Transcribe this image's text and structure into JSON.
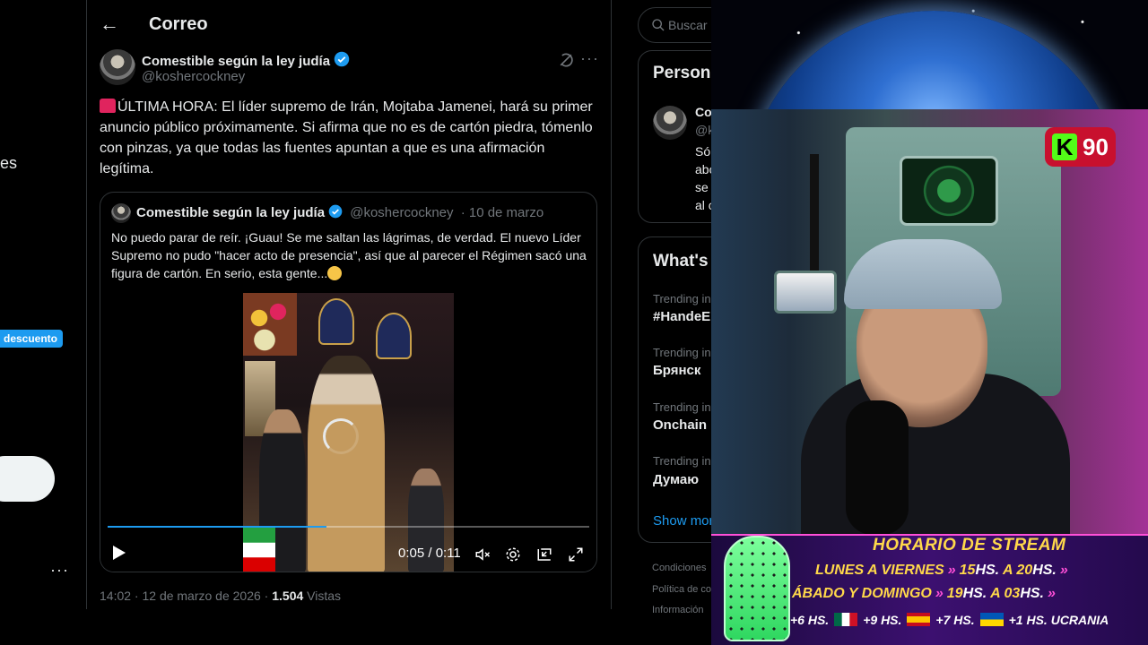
{
  "left_nav": {
    "partial_text": "es",
    "discount_badge": "descuento",
    "more_label": "···"
  },
  "header": {
    "title": "Correo",
    "back_icon": "arrow-left-icon"
  },
  "tweet": {
    "author_name": "Comestible según la ley judía",
    "author_handle": "@koshercockney",
    "text": "ÚLTIMA HORA: El líder supremo de Irán, Mojtaba Jamenei, hará su primer anuncio público próximamente. Si afirma que no es de cartón piedra, tómenlo con pinzas, ya que todas las fuentes apuntan a que es una afirmación legítima.",
    "more_label": "···",
    "timestamp": "14:02 · 12 de marzo de 2026 ·",
    "views_count": "1.504",
    "views_label": "Vistas"
  },
  "quote": {
    "author_name": "Comestible según la ley judía",
    "author_handle": "@koshercockney",
    "date": "· 10 de marzo",
    "text": "No puedo parar de reír. ¡Guau! Se me saltan las lágrimas, de verdad. El nuevo Líder Supremo no pudo \"hacer acto de presencia\", así que al parecer el Régimen sacó una figura de cartón. En serio, esta gente...",
    "video": {
      "time": "0:05 / 0:11",
      "progress": 0.455
    }
  },
  "sidebar": {
    "search_placeholder": "Buscar",
    "people_title": "Person",
    "person_name_frag": "Co",
    "person_handle_frag": "@k",
    "bio_frags": [
      "Só",
      "abo",
      "se",
      "al c"
    ],
    "trends_title": "What's",
    "trends": [
      {
        "label": "Trending in",
        "name": "#HandeE"
      },
      {
        "label": "Trending in",
        "name": "Брянск"
      },
      {
        "label": "Trending in",
        "name": "Onchain"
      },
      {
        "label": "Trending in",
        "name": "Думаю"
      }
    ],
    "show_more": "Show mor",
    "footer": [
      "Condiciones",
      "Política de co",
      "Información"
    ]
  },
  "stream": {
    "viewer_count": "90",
    "kick_logo": "K",
    "schedule_title": "HORARIO DE STREAM",
    "row1_days": "LUNES A VIERNES",
    "row1_from": "15",
    "row1_to": "20",
    "row2_days": "ÁBADO Y DOMINGO",
    "row2_from": "19",
    "row2_to": "03",
    "hs": "HS.",
    "a": "A",
    "tz": [
      "+6",
      "+9",
      "+7",
      "+1"
    ],
    "tz_country": "UCRANIA",
    "colors": {
      "kick_green": "#53fc18",
      "schedule_yellow": "#ffd84a",
      "accent_pink": "#ff4fd8"
    }
  },
  "colors": {
    "link_blue": "#1d9bf0",
    "text": "#e7e9ea",
    "muted": "#71767b",
    "border": "#2f3336"
  }
}
